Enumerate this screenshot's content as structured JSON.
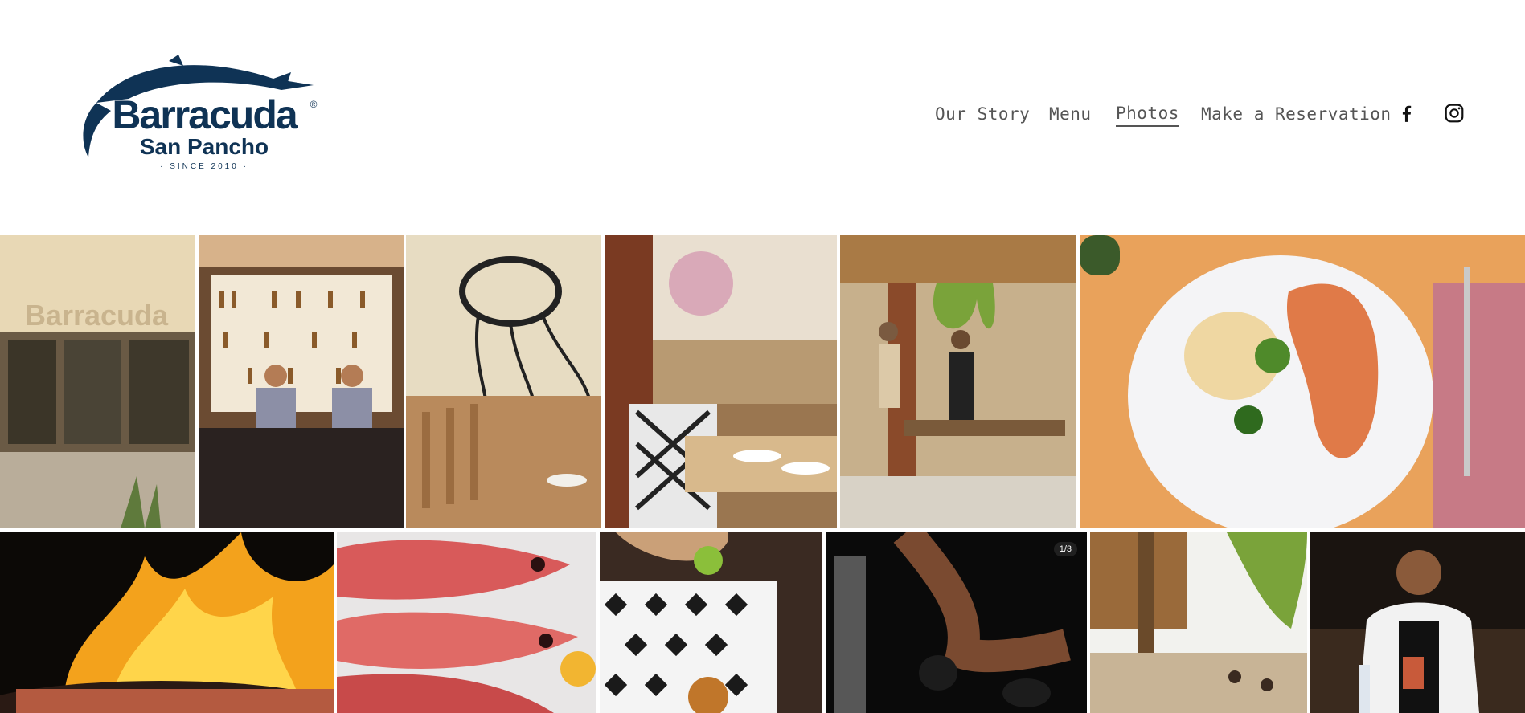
{
  "brand": {
    "name": "Barracuda",
    "subtitle": "San Pancho",
    "tagline": "· SINCE 2010 ·",
    "registered": "®",
    "color": "#0f3355"
  },
  "nav": {
    "items": [
      {
        "label": "Our Story",
        "active": false
      },
      {
        "label": "Menu",
        "active": false
      },
      {
        "label": "Photos",
        "active": true
      },
      {
        "label": "Make a Reservation",
        "active": false
      }
    ],
    "social": [
      {
        "icon": "facebook-icon"
      },
      {
        "icon": "instagram-icon"
      }
    ]
  },
  "gallery": {
    "row1": [
      {
        "subject": "restaurant-exterior",
        "sign_text": "Barracuda"
      },
      {
        "subject": "bar-bartenders"
      },
      {
        "subject": "interior-octopus-mural"
      },
      {
        "subject": "patio-chairs"
      },
      {
        "subject": "terrace-guests"
      },
      {
        "subject": "lobster-plate"
      }
    ],
    "row2": [
      {
        "subject": "flame-grill"
      },
      {
        "subject": "red-snapper"
      },
      {
        "subject": "lime-squeeze"
      },
      {
        "subject": "mezcal-pour",
        "counter": "1/3"
      },
      {
        "subject": "palapa-dining"
      },
      {
        "subject": "chef-with-cocktail"
      }
    ]
  }
}
